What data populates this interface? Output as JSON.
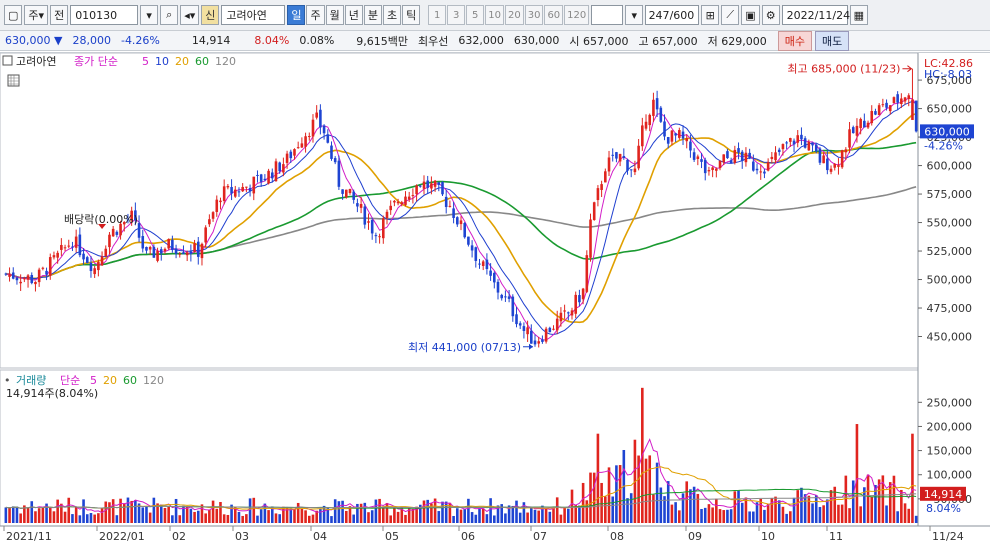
{
  "toolbar": {
    "menu_icon": "window-icon",
    "market_label": "주",
    "all_label": "전",
    "code_value": "010130",
    "search_icon": "search-icon",
    "sound_icon": "speaker-icon",
    "new_badge": "신",
    "stock_name": "고려아연",
    "periods": [
      "일",
      "주",
      "월",
      "년",
      "분",
      "초",
      "틱"
    ],
    "intervals": [
      "1",
      "3",
      "5",
      "10",
      "20",
      "30",
      "60",
      "120"
    ],
    "count_value": "247",
    "count_total": "/600",
    "date_value": "2022/11/24"
  },
  "quote": {
    "price": "630,000",
    "change": "28,000",
    "change_pct": "-4.26%",
    "volume": "14,914",
    "volume_pct": "8.04%",
    "turnover_pct": "0.08%",
    "amount": "9,615백만",
    "best_label": "최우선",
    "best_ask": "632,000",
    "best_bid": "630,000",
    "open_label": "시",
    "open": "657,000",
    "high_label": "고",
    "high": "657,000",
    "low_label": "저",
    "low": "629,000",
    "buy_label": "매수",
    "sell_label": "매도"
  },
  "price_panel": {
    "title": "고려아연",
    "ma_label": "종가 단순",
    "ma_periods": [
      "5",
      "10",
      "20",
      "60",
      "120"
    ],
    "ma_colors": [
      "#d21ec8",
      "#1f3fcf",
      "#e0a000",
      "#1a9a30",
      "#888888"
    ],
    "lc_label": "LC:42.86",
    "hc_label": "HC:-8.03",
    "current_tag": "630,000",
    "current_pct": "-4.26%",
    "dividend_label": "배당락(0.00%)",
    "high_annotation": "최고 685,000 (11/23)",
    "low_annotation": "최저 441,000 (07/13)"
  },
  "volume_panel": {
    "title": "거래량",
    "ma_label": "단순",
    "ma_periods": [
      "5",
      "20",
      "60",
      "120"
    ],
    "ma_colors": [
      "#d21ec8",
      "#e0a000",
      "#1a9a30",
      "#888888"
    ],
    "info": "14,914주(8.04%)",
    "current_tag": "14,914",
    "current_pct": "8.04%"
  },
  "x_axis": {
    "labels": [
      "2021/11",
      "2022/01",
      "02",
      "03",
      "04",
      "05",
      "06",
      "07",
      "08",
      "09",
      "10",
      "11",
      "11/24"
    ]
  },
  "chart_data": {
    "type": "candlestick",
    "price_axis": {
      "ticks": [
        "675,000",
        "650,000",
        "625,000",
        "600,000",
        "575,000",
        "550,000",
        "525,000",
        "500,000",
        "475,000",
        "450,000"
      ],
      "ylim": [
        425000,
        690000
      ]
    },
    "volume_axis": {
      "ticks": [
        "250,000",
        "200,000",
        "150,000",
        "100,000",
        "50,000"
      ],
      "ylim": [
        0,
        290000
      ]
    },
    "price_keypoints": [
      [
        0,
        505000
      ],
      [
        8,
        500000
      ],
      [
        14,
        520000
      ],
      [
        18,
        535000
      ],
      [
        24,
        510000
      ],
      [
        28,
        540000
      ],
      [
        34,
        555000
      ],
      [
        38,
        520000
      ],
      [
        44,
        530000
      ],
      [
        52,
        525000
      ],
      [
        58,
        575000
      ],
      [
        64,
        580000
      ],
      [
        70,
        590000
      ],
      [
        76,
        605000
      ],
      [
        80,
        625000
      ],
      [
        84,
        640000
      ],
      [
        86,
        630000
      ],
      [
        90,
        585000
      ],
      [
        96,
        560000
      ],
      [
        100,
        540000
      ],
      [
        106,
        570000
      ],
      [
        112,
        585000
      ],
      [
        116,
        580000
      ],
      [
        120,
        565000
      ],
      [
        124,
        540000
      ],
      [
        128,
        515000
      ],
      [
        132,
        495000
      ],
      [
        136,
        478000
      ],
      [
        140,
        455000
      ],
      [
        143,
        446000
      ],
      [
        148,
        460000
      ],
      [
        152,
        470000
      ],
      [
        156,
        490000
      ],
      [
        158,
        550000
      ],
      [
        162,
        600000
      ],
      [
        166,
        608000
      ],
      [
        170,
        595000
      ],
      [
        173,
        645000
      ],
      [
        175,
        655000
      ],
      [
        178,
        625000
      ],
      [
        182,
        625000
      ],
      [
        186,
        610000
      ],
      [
        190,
        590000
      ],
      [
        194,
        605000
      ],
      [
        198,
        610000
      ],
      [
        202,
        600000
      ],
      [
        206,
        600000
      ],
      [
        210,
        615000
      ],
      [
        214,
        625000
      ],
      [
        216,
        620000
      ],
      [
        220,
        605000
      ],
      [
        224,
        600000
      ],
      [
        228,
        625000
      ],
      [
        232,
        640000
      ],
      [
        236,
        650000
      ],
      [
        240,
        655000
      ],
      [
        244,
        665000
      ],
      [
        246,
        630000
      ]
    ],
    "volume_keypoints": [
      [
        0,
        30000
      ],
      [
        40,
        30000
      ],
      [
        100,
        28000
      ],
      [
        150,
        30000
      ],
      [
        158,
        60000
      ],
      [
        165,
        70000
      ],
      [
        170,
        120000
      ],
      [
        176,
        60000
      ],
      [
        190,
        40000
      ],
      [
        210,
        35000
      ],
      [
        230,
        60000
      ],
      [
        240,
        55000
      ],
      [
        246,
        14914
      ]
    ],
    "volume_spikes": [
      [
        172,
        280000
      ],
      [
        174,
        140000
      ],
      [
        176,
        125000
      ],
      [
        160,
        185000
      ],
      [
        230,
        205000
      ],
      [
        245,
        185000
      ],
      [
        233,
        100000
      ]
    ],
    "annotations": {
      "high": {
        "value": 685000,
        "date": "11/23"
      },
      "low": {
        "value": 441000,
        "date": "07/13"
      },
      "dividend": "배당락(0.00%)"
    },
    "bars_shown": 247
  }
}
